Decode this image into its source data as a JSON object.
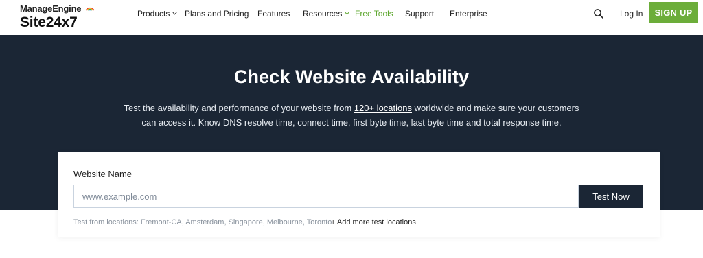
{
  "brand": {
    "company": "ManageEngine",
    "product": "Site24x7"
  },
  "nav": {
    "items": [
      {
        "label": "Products",
        "dropdown": true
      },
      {
        "label": "Plans and Pricing",
        "dropdown": false
      },
      {
        "label": "Features",
        "dropdown": false
      },
      {
        "label": "Resources",
        "dropdown": true
      },
      {
        "label": "Free Tools",
        "dropdown": false
      },
      {
        "label": "Support",
        "dropdown": false
      },
      {
        "label": "Enterprise",
        "dropdown": false
      }
    ],
    "login_label": "Log In",
    "signup_label": "SIGN UP"
  },
  "hero": {
    "title": "Check Website Availability",
    "desc_before": "Test the availability and performance of your website from ",
    "desc_link": "120+ locations",
    "desc_after": " worldwide and make sure your customers can access it. Know DNS resolve time, connect time, first byte time, last byte time and total response time."
  },
  "form": {
    "label": "Website Name",
    "input_value": "",
    "placeholder": "www.example.com",
    "button_label": "Test Now",
    "locations_note": "Test from locations: Fremont-CA, Amsterdam, Singapore, Melbourne, Toronto",
    "add_locations_label": "+ Add more test locations"
  },
  "colors": {
    "hero_bg": "#1b2635",
    "accent_green": "#6cad3a",
    "free_tools_green": "#5ea72f"
  },
  "icons": {
    "search": "search-icon",
    "chevron": "chevron-down-icon"
  }
}
